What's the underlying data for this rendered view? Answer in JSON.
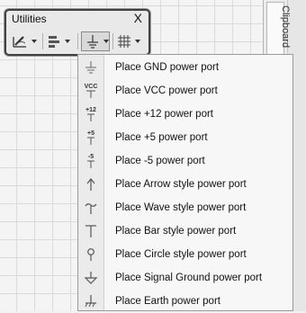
{
  "toolbar": {
    "title": "Utilities",
    "close_label": "X",
    "buttons": [
      {
        "icon": "drawing-tools-icon"
      },
      {
        "icon": "alignment-icon"
      },
      {
        "icon": "power-port-icon"
      },
      {
        "icon": "grid-icon"
      }
    ]
  },
  "side_panel": {
    "tab_label": "Clipboard"
  },
  "menu": {
    "items": [
      {
        "label": "Place GND power port",
        "icon": "gnd-power-port-icon"
      },
      {
        "label": "Place VCC power port",
        "icon": "vcc-power-port-icon",
        "icon_text": "VCC"
      },
      {
        "label": "Place +12 power port",
        "icon": "plus12-power-port-icon",
        "icon_text": "+12"
      },
      {
        "label": "Place +5 power port",
        "icon": "plus5-power-port-icon",
        "icon_text": "+5"
      },
      {
        "label": "Place -5 power port",
        "icon": "minus5-power-port-icon",
        "icon_text": "-5"
      },
      {
        "label": "Place Arrow style power port",
        "icon": "arrow-power-port-icon"
      },
      {
        "label": "Place Wave style power port",
        "icon": "wave-power-port-icon"
      },
      {
        "label": "Place Bar style power port",
        "icon": "bar-power-port-icon"
      },
      {
        "label": "Place Circle style power port",
        "icon": "circle-power-port-icon"
      },
      {
        "label": "Place Signal Ground power port",
        "icon": "signal-ground-power-port-icon"
      },
      {
        "label": "Place Earth power port",
        "icon": "earth-power-port-icon"
      }
    ]
  }
}
